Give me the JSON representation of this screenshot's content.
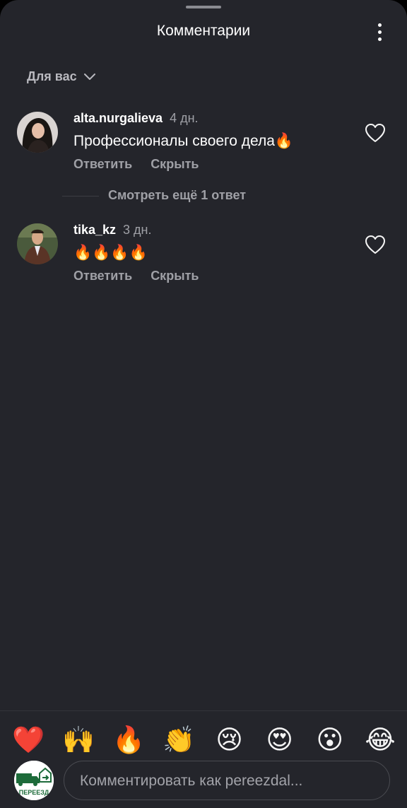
{
  "header": {
    "title": "Комментарии"
  },
  "filter": {
    "label": "Для вас"
  },
  "comments": [
    {
      "username": "alta.nurgalieva",
      "time": "4 дн.",
      "text": "Профессионалы своего дела🔥",
      "reply_label": "Ответить",
      "hide_label": "Скрыть"
    },
    {
      "username": "tika_kz",
      "time": "3 дн.",
      "text": "🔥🔥🔥🔥",
      "reply_label": "Ответить",
      "hide_label": "Скрыть"
    }
  ],
  "more_replies": {
    "label": "Смотреть ещё 1 ответ"
  },
  "quick_emojis": [
    "❤️",
    "🙌",
    "🔥",
    "👏",
    "😢",
    "😍",
    "😮",
    "😂"
  ],
  "composer": {
    "placeholder": "Комментировать как pereezdal...",
    "avatar_text": "ПЕРЕЕЗД"
  },
  "icons": {
    "menu": "more-vertical-icon",
    "filter": "chevron-down-icon",
    "like": "heart-outline-icon",
    "sticker": "sticker-icon"
  },
  "colors": {
    "background": "#24252b",
    "text_primary": "#ffffff",
    "text_secondary": "#9fa0a6",
    "brand_green": "#1d6b3a"
  }
}
